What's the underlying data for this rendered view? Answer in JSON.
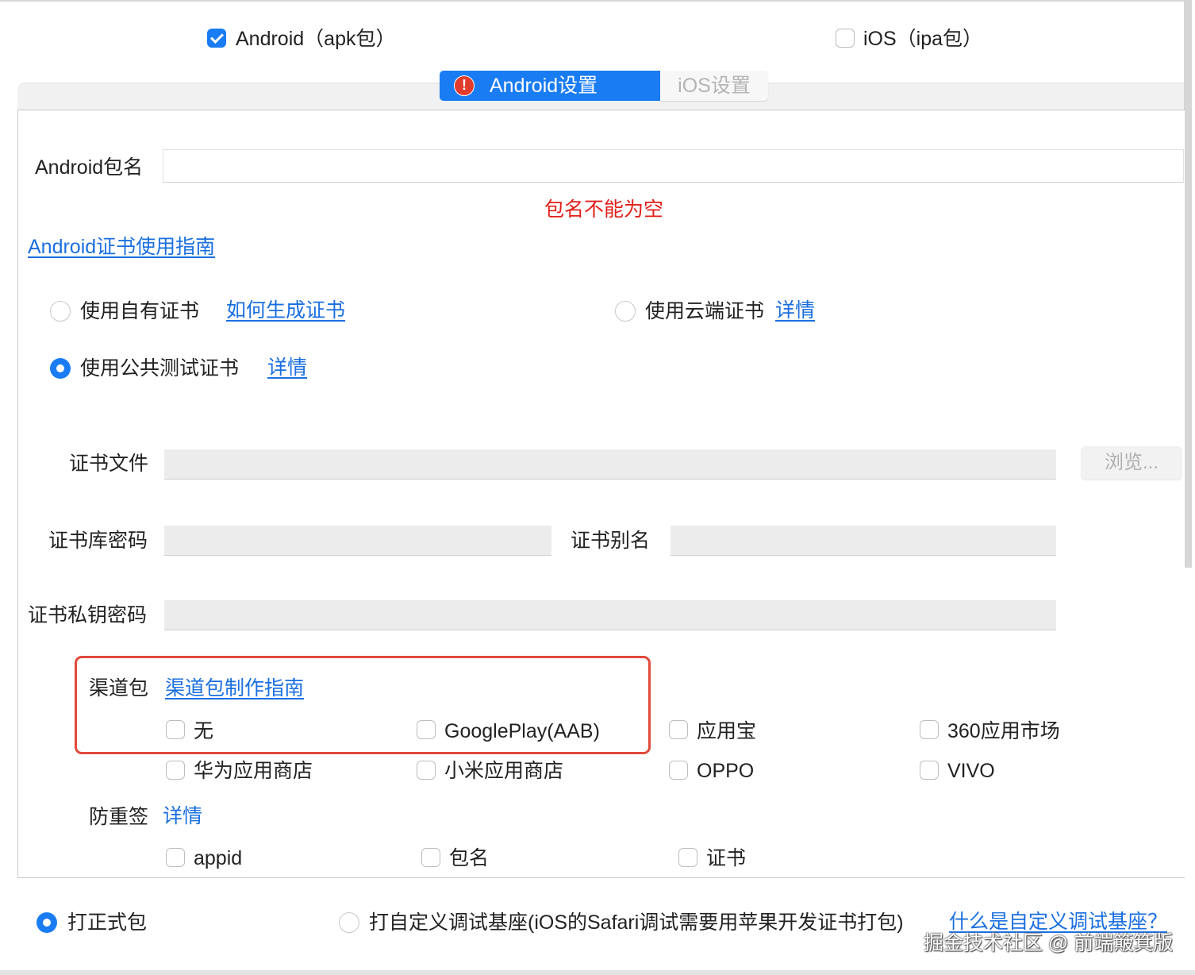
{
  "platforms": {
    "android": {
      "label": "Android（apk包）",
      "checked": true
    },
    "ios": {
      "label": "iOS（ipa包）",
      "checked": false
    }
  },
  "tabs": {
    "android": "Android设置",
    "ios": "iOS设置",
    "android_warning_icon": "!"
  },
  "package": {
    "label": "Android包名",
    "value": "",
    "error": "包名不能为空"
  },
  "cert_guide_link": "Android证书使用指南",
  "cert_options": {
    "own": {
      "label": "使用自有证书",
      "link": "如何生成证书",
      "selected": false
    },
    "cloud": {
      "label": "使用云端证书",
      "link": "详情",
      "selected": false
    },
    "public": {
      "label": "使用公共测试证书",
      "link": "详情",
      "selected": true
    }
  },
  "cert_fields": {
    "file_label": "证书文件",
    "browse_label": "浏览...",
    "store_password_label": "证书库密码",
    "alias_label": "证书别名",
    "key_password_label": "证书私钥密码"
  },
  "channel": {
    "label": "渠道包",
    "guide_link": "渠道包制作指南",
    "options": [
      "无",
      "GooglePlay(AAB)",
      "应用宝",
      "360应用市场",
      "华为应用商店",
      "小米应用商店",
      "OPPO",
      "VIVO"
    ]
  },
  "anti_resign": {
    "label": "防重签",
    "link": "详情",
    "options": [
      "appid",
      "包名",
      "证书"
    ]
  },
  "build": {
    "formal_label": "打正式包",
    "formal_selected": true,
    "custom_label": "打自定义调试基座(iOS的Safari调试需要用苹果开发证书打包)",
    "custom_selected": false,
    "custom_link": "什么是自定义调试基座？"
  },
  "watermark": "掘金技术社区 @ 前端簸箕版",
  "colors": {
    "accent": "#1a7cf3",
    "link": "#1a6fe0",
    "error": "#e0201a",
    "highlight_box": "#e04a3b"
  }
}
